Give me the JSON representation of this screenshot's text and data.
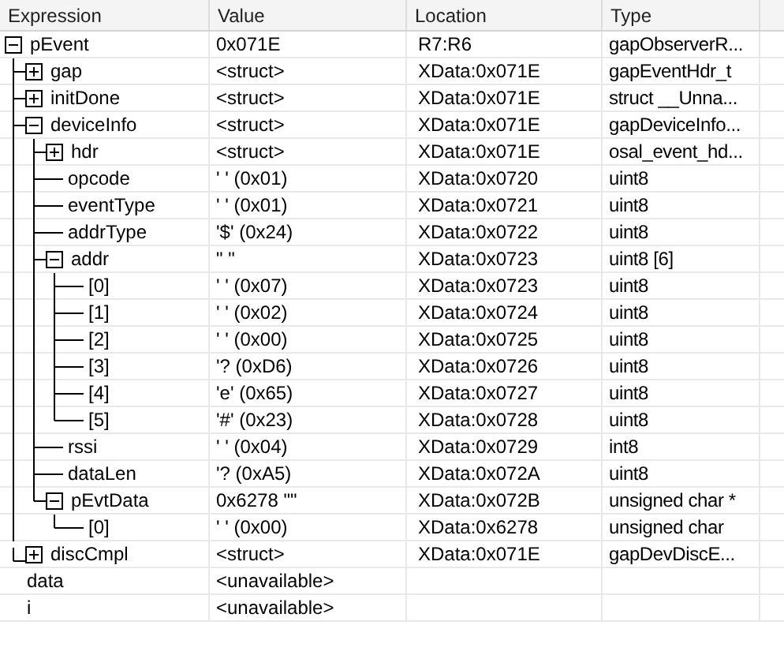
{
  "columns": [
    "Expression",
    "Value",
    "Location",
    "Type"
  ],
  "rows": [
    {
      "expression": "pEvent",
      "value": "0x071E",
      "location": "R7:R6",
      "type": "gapObserverR...",
      "expanded": true,
      "children": [
        {
          "expression": "gap",
          "value": "<struct>",
          "location": "XData:0x071E",
          "type": "gapEventHdr_t",
          "expanded": false
        },
        {
          "expression": "initDone",
          "value": "<struct>",
          "location": "XData:0x071E",
          "type": "struct __Unna...",
          "expanded": false
        },
        {
          "expression": "deviceInfo",
          "value": "<struct>",
          "location": "XData:0x071E",
          "type": "gapDeviceInfo...",
          "expanded": true,
          "children": [
            {
              "expression": "hdr",
              "value": "<struct>",
              "location": "XData:0x071E",
              "type": "osal_event_hd...",
              "expanded": false
            },
            {
              "expression": "opcode",
              "value": "' ' (0x01)",
              "location": "XData:0x0720",
              "type": "uint8"
            },
            {
              "expression": "eventType",
              "value": "' ' (0x01)",
              "location": "XData:0x0721",
              "type": "uint8"
            },
            {
              "expression": "addrType",
              "value": "'$' (0x24)",
              "location": "XData:0x0722",
              "type": "uint8"
            },
            {
              "expression": "addr",
              "value": "\" \"",
              "location": "XData:0x0723",
              "type": "uint8 [6]",
              "expanded": true,
              "children": [
                {
                  "expression": "[0]",
                  "value": "' ' (0x07)",
                  "location": "XData:0x0723",
                  "type": "uint8"
                },
                {
                  "expression": "[1]",
                  "value": "' ' (0x02)",
                  "location": "XData:0x0724",
                  "type": "uint8"
                },
                {
                  "expression": "[2]",
                  "value": "' ' (0x00)",
                  "location": "XData:0x0725",
                  "type": "uint8"
                },
                {
                  "expression": "[3]",
                  "value": "'? (0xD6)",
                  "location": "XData:0x0726",
                  "type": "uint8"
                },
                {
                  "expression": "[4]",
                  "value": "'e' (0x65)",
                  "location": "XData:0x0727",
                  "type": "uint8"
                },
                {
                  "expression": "[5]",
                  "value": "'#' (0x23)",
                  "location": "XData:0x0728",
                  "type": "uint8"
                }
              ]
            },
            {
              "expression": "rssi",
              "value": "' ' (0x04)",
              "location": "XData:0x0729",
              "type": "int8"
            },
            {
              "expression": "dataLen",
              "value": "'? (0xA5)",
              "location": "XData:0x072A",
              "type": "uint8"
            },
            {
              "expression": "pEvtData",
              "value": "0x6278 \"\"",
              "location": "XData:0x072B",
              "type": "unsigned char *",
              "expanded": true,
              "children": [
                {
                  "expression": "[0]",
                  "value": "' ' (0x00)",
                  "location": "XData:0x6278",
                  "type": "unsigned char"
                }
              ]
            }
          ]
        },
        {
          "expression": "discCmpl",
          "value": "<struct>",
          "location": "XData:0x071E",
          "type": "gapDevDiscE...",
          "expanded": false
        }
      ]
    },
    {
      "expression": "data",
      "value": "<unavailable>"
    },
    {
      "expression": "i",
      "value": "<unavailable>"
    }
  ]
}
